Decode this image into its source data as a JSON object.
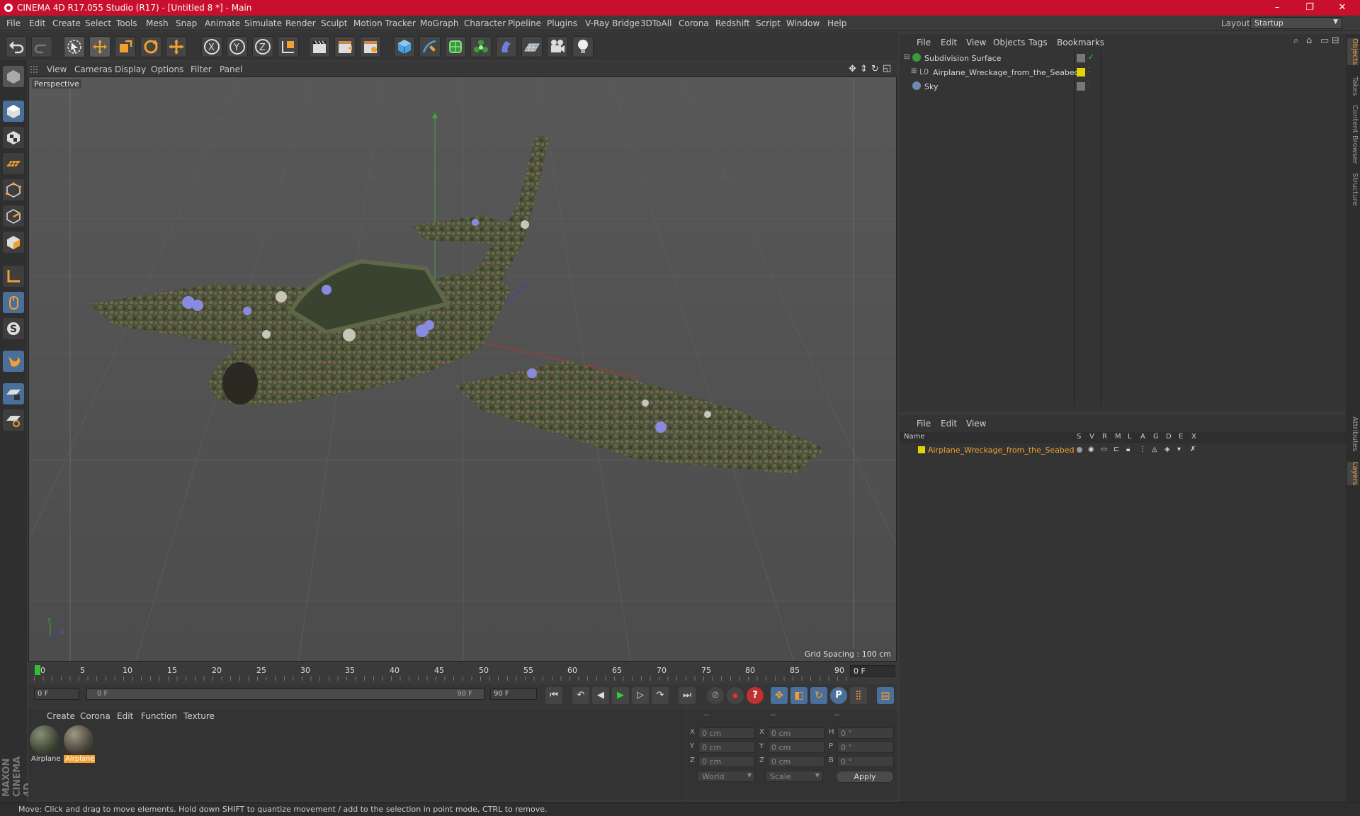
{
  "window": {
    "title": "CINEMA 4D R17.055 Studio (R17) - [Untitled 8 *] - Main",
    "minimize": "–",
    "restore": "❐",
    "close": "✕"
  },
  "menu": [
    "File",
    "Edit",
    "Create",
    "Select",
    "Tools",
    "Mesh",
    "Snap",
    "Animate",
    "Simulate",
    "Render",
    "Sculpt",
    "Motion Tracker",
    "MoGraph",
    "Character",
    "Pipeline",
    "Plugins",
    "V-Ray Bridge",
    "3DToAll",
    "Corona",
    "Redshift",
    "Script",
    "Window",
    "Help"
  ],
  "layout": {
    "label": "Layout:",
    "value": "Startup"
  },
  "toolbar": {
    "x_label": "X",
    "y_label": "Y",
    "z_label": "Z"
  },
  "viewport": {
    "menu": [
      "View",
      "Cameras",
      "Display",
      "Options",
      "Filter",
      "Panel"
    ],
    "label": "Perspective",
    "grid_spacing": "Grid Spacing : 100 cm"
  },
  "timeline": {
    "ticks": [
      "0",
      "5",
      "10",
      "15",
      "20",
      "25",
      "30",
      "35",
      "40",
      "45",
      "50",
      "55",
      "60",
      "65",
      "70",
      "75",
      "80",
      "85",
      "90"
    ],
    "current_frame": "0 F",
    "start": "0 F",
    "range_start": "0 F",
    "range_end": "90 F",
    "end": "90 F"
  },
  "materials": {
    "menu": [
      "Create",
      "Corona",
      "Edit",
      "Function",
      "Texture"
    ],
    "items": [
      {
        "label": "Airplane",
        "selected": false
      },
      {
        "label": "Airplane",
        "selected": true
      }
    ]
  },
  "coords": {
    "headers": [
      "--",
      "--",
      "--"
    ],
    "rows": [
      {
        "a": "X",
        "av": "0 cm",
        "b": "X",
        "bv": "0 cm",
        "c": "H",
        "cv": "0 °"
      },
      {
        "a": "Y",
        "av": "0 cm",
        "b": "Y",
        "bv": "0 cm",
        "c": "P",
        "cv": "0 °"
      },
      {
        "a": "Z",
        "av": "0 cm",
        "b": "Z",
        "bv": "0 cm",
        "c": "B",
        "cv": "0 °"
      }
    ],
    "world": "World",
    "scale": "Scale",
    "apply": "Apply"
  },
  "objects": {
    "menu": [
      "File",
      "Edit",
      "View",
      "Objects",
      "Tags",
      "Bookmarks"
    ],
    "items": [
      {
        "name": "Subdivision Surface",
        "indent": 0
      },
      {
        "name": "Airplane_Wreckage_from_the_Seabed",
        "indent": 1
      },
      {
        "name": "Sky",
        "indent": 0
      }
    ]
  },
  "layers": {
    "menu": [
      "File",
      "Edit",
      "View"
    ],
    "columns": [
      "Name",
      "S",
      "V",
      "R",
      "M",
      "L",
      "A",
      "G",
      "D",
      "E",
      "X"
    ],
    "items": [
      {
        "name": "Airplane_Wreckage_from_the_Seabed"
      }
    ]
  },
  "right_tabs": [
    "Objects",
    "Takes",
    "Content Browser",
    "Structure",
    "Attributes",
    "Layers"
  ],
  "brand": "MAXON CINEMA 4D",
  "status": "Move: Click and drag to move elements. Hold down SHIFT to quantize movement / add to the selection in point mode, CTRL to remove.",
  "colors": {
    "accent": "#f0a030",
    "title_bar": "#c8102e",
    "layer_yellow": "#e6d200"
  }
}
